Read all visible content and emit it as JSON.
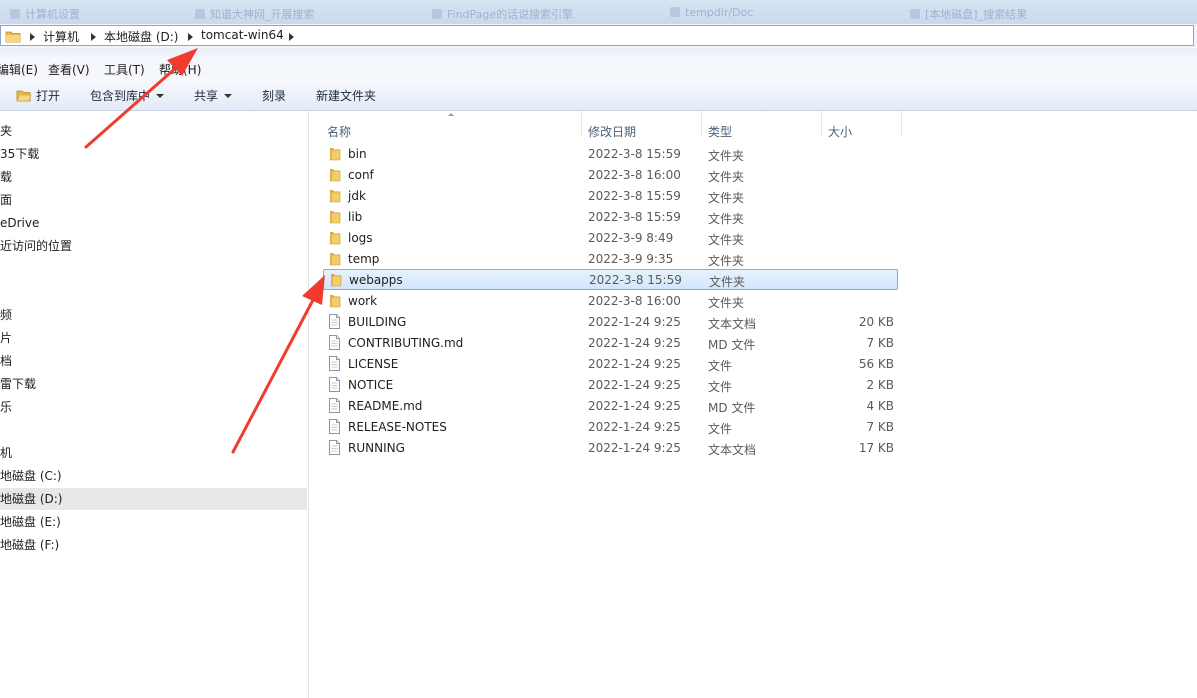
{
  "background_tabs": [
    "计算机设置",
    "知道大神网_开展搜索",
    "FindPage的话说搜索引擎",
    "tempdir/Doc",
    "[本地磁盘]_搜索结果"
  ],
  "breadcrumb": [
    "计算机",
    "本地磁盘 (D:)",
    "tomcat-win64"
  ],
  "menu": [
    "编辑(E)",
    "查看(V)",
    "工具(T)",
    "帮助(H)"
  ],
  "toolbar": {
    "open": "打开",
    "include": "包含到库中",
    "share": "共享",
    "burn": "刻录",
    "new_folder": "新建文件夹"
  },
  "nav_items": [
    "夹",
    "35下载",
    "载",
    "面",
    "eDrive",
    "近访问的位置",
    "",
    "",
    "频",
    "片",
    "档",
    "雷下载",
    "乐",
    "",
    "机",
    "地磁盘 (C:)",
    "地磁盘 (D:)",
    "地磁盘 (E:)",
    "地磁盘 (F:)"
  ],
  "nav_selected_index": 16,
  "columns": {
    "name": "名称",
    "date": "修改日期",
    "type": "类型",
    "size": "大小"
  },
  "files": [
    {
      "name": "bin",
      "date": "2022-3-8 15:59",
      "type": "文件夹",
      "size": "",
      "kind": "folder"
    },
    {
      "name": "conf",
      "date": "2022-3-8 16:00",
      "type": "文件夹",
      "size": "",
      "kind": "folder"
    },
    {
      "name": "jdk",
      "date": "2022-3-8 15:59",
      "type": "文件夹",
      "size": "",
      "kind": "folder"
    },
    {
      "name": "lib",
      "date": "2022-3-8 15:59",
      "type": "文件夹",
      "size": "",
      "kind": "folder"
    },
    {
      "name": "logs",
      "date": "2022-3-9 8:49",
      "type": "文件夹",
      "size": "",
      "kind": "folder"
    },
    {
      "name": "temp",
      "date": "2022-3-9 9:35",
      "type": "文件夹",
      "size": "",
      "kind": "folder"
    },
    {
      "name": "webapps",
      "date": "2022-3-8 15:59",
      "type": "文件夹",
      "size": "",
      "kind": "folder"
    },
    {
      "name": "work",
      "date": "2022-3-8 16:00",
      "type": "文件夹",
      "size": "",
      "kind": "folder"
    },
    {
      "name": "BUILDING",
      "date": "2022-1-24 9:25",
      "type": "文本文档",
      "size": "20 KB",
      "kind": "file"
    },
    {
      "name": "CONTRIBUTING.md",
      "date": "2022-1-24 9:25",
      "type": "MD 文件",
      "size": "7 KB",
      "kind": "file"
    },
    {
      "name": "LICENSE",
      "date": "2022-1-24 9:25",
      "type": "文件",
      "size": "56 KB",
      "kind": "file"
    },
    {
      "name": "NOTICE",
      "date": "2022-1-24 9:25",
      "type": "文件",
      "size": "2 KB",
      "kind": "file"
    },
    {
      "name": "README.md",
      "date": "2022-1-24 9:25",
      "type": "MD 文件",
      "size": "4 KB",
      "kind": "file"
    },
    {
      "name": "RELEASE-NOTES",
      "date": "2022-1-24 9:25",
      "type": "文件",
      "size": "7 KB",
      "kind": "file"
    },
    {
      "name": "RUNNING",
      "date": "2022-1-24 9:25",
      "type": "文本文档",
      "size": "17 KB",
      "kind": "file"
    }
  ],
  "selected_file_index": 6,
  "colors": {
    "annotation_arrow": "#f03c2e",
    "folder": "#e8b84a",
    "selection_border": "#84acdd"
  },
  "icons": {
    "folder": "folder-icon",
    "file": "document-icon",
    "open": "open-folder-icon"
  }
}
